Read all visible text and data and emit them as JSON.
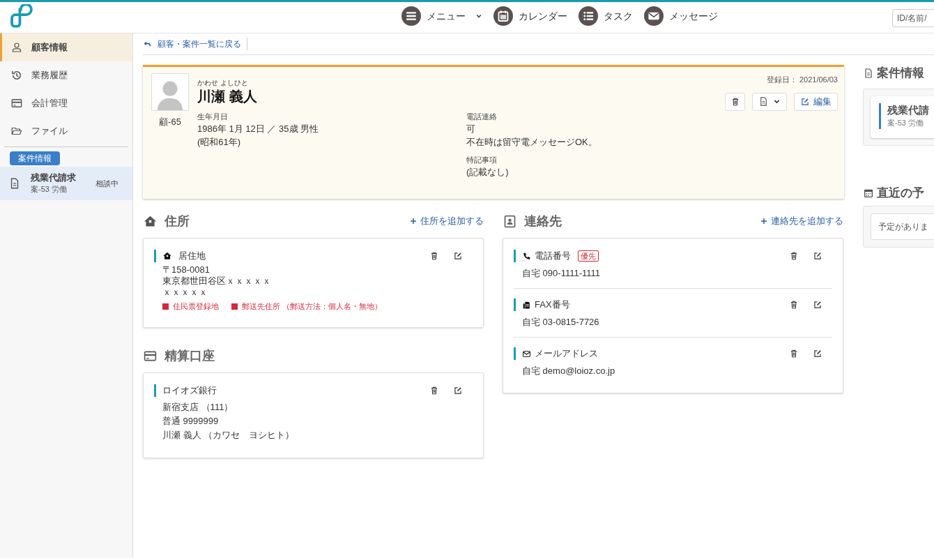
{
  "header": {
    "nav": [
      {
        "kind": "menu",
        "label": "メニュー",
        "dropdown": true
      },
      {
        "kind": "calendar",
        "label": "カレンダー",
        "dropdown": false
      },
      {
        "kind": "tasks",
        "label": "タスク",
        "dropdown": false
      },
      {
        "kind": "mail",
        "label": "メッセージ",
        "dropdown": false
      }
    ],
    "search": {
      "placeholder": "ID/名前/"
    }
  },
  "sidebar": {
    "items": [
      {
        "kind": "person",
        "label": "顧客情報",
        "selected": true
      },
      {
        "kind": "history",
        "label": "業務履歴",
        "selected": false
      },
      {
        "kind": "card",
        "label": "会計管理",
        "selected": false
      },
      {
        "kind": "folder",
        "label": "ファイル",
        "selected": false
      }
    ],
    "section_badge": "案件情報",
    "cases": [
      {
        "title": "残業代請求",
        "subtitle": "案-53 労働",
        "status": "相談中",
        "selected": true
      }
    ]
  },
  "back_link": "顧客・案件一覧に戻る",
  "customer": {
    "furigana": "かわせ よしひと",
    "name": "川瀬 義人",
    "id": "顧-65",
    "registered": "登録日： 2021/06/03",
    "edit_button": "編集",
    "columns": [
      [
        {
          "label": "生年月日",
          "lines": [
            "1986年 1月 12日 ／ 35歳 男性",
            "(昭和61年)"
          ]
        }
      ],
      [
        {
          "label": "電話連絡",
          "lines": [
            "可",
            "不在時は留守電メッセージOK。"
          ]
        },
        {
          "label": "特記事項",
          "lines": [
            "(記載なし)"
          ]
        }
      ]
    ]
  },
  "address": {
    "title": "住所",
    "add_link": "住所を追加する",
    "entries": [
      {
        "label": "居住地",
        "lines": [
          "〒158-0081",
          "東京都世田谷区ｘｘｘｘｘ",
          "ｘｘｘｘｘ"
        ],
        "tags": [
          "住民票登録地",
          "郵送先住所 （郵送方法：個人名・無地）"
        ]
      }
    ]
  },
  "bank": {
    "title": "精算口座",
    "entries": [
      {
        "label": "ロイオズ銀行",
        "lines": [
          "新宿支店 （111）",
          "普通 9999999",
          "川瀬 義人 （カワセ　ヨシヒト）"
        ]
      }
    ]
  },
  "contacts": {
    "title": "連絡先",
    "add_link": "連絡先を追加する",
    "entries": [
      {
        "kind": "phone",
        "label": "電話番号",
        "badge": "優先",
        "value": "自宅 090-1111-1111"
      },
      {
        "kind": "fax",
        "label": "FAX番号",
        "value": "自宅 03-0815-7726"
      },
      {
        "kind": "mail",
        "label": "メールアドレス",
        "value": "自宅 demo@loioz.co.jp"
      }
    ]
  },
  "side": {
    "case_title": "案件情報",
    "cases": [
      {
        "title": "残業代請",
        "subtitle": "案-53 労働"
      }
    ],
    "schedule_title": "直近の予",
    "schedule_empty": "予定がありま"
  }
}
